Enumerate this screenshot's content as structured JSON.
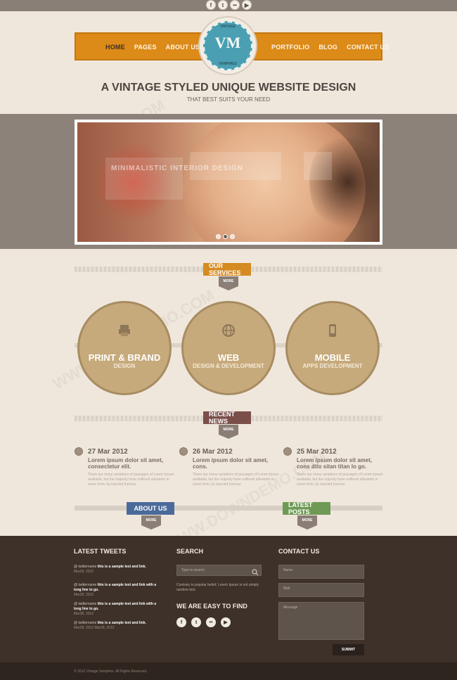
{
  "social_top": [
    "f",
    "t",
    "••",
    "▶"
  ],
  "nav": {
    "left": [
      "HOME",
      "PAGES",
      "ABOUT US"
    ],
    "right": [
      "PORTFOLIO",
      "BLOG",
      "CONTACT US"
    ]
  },
  "logo": {
    "top": "VINTAGE",
    "initials": "VM",
    "bottom": "VAMPIRES"
  },
  "hero": {
    "title": "A VINTAGE STYLED UNIQUE WEBSITE DESIGN",
    "subtitle": "THAT BEST SUITS YOUR NEED",
    "overlay_text": "MINIMALISTIC INTERIOR DESIGN"
  },
  "services": {
    "tag": "OUR SERVICES",
    "more": "MORE",
    "items": [
      {
        "title": "PRINT & BRAND",
        "sub": "DESIGN",
        "icon": "printer-icon"
      },
      {
        "title": "WEB",
        "sub": "DESIGN & DEVELOPMENT",
        "icon": "globe-icon"
      },
      {
        "title": "MOBILE",
        "sub": "APPS DEVELOPMENT",
        "icon": "mobile-icon"
      }
    ]
  },
  "news": {
    "tag": "RECENT NEWS",
    "more": "MORE",
    "items": [
      {
        "date": "27 Mar 2012",
        "headline": "Lorem ipsum dolor sit amet, consectetur elit.",
        "body": "There are many variations of passages of Lorem Ipsum available, but the majority have suffered alteration in some form, by injected humour."
      },
      {
        "date": "26 Mar 2012",
        "headline": "Lorem ipsum dolor sit amet, cons.",
        "body": "There are many variations of passages of Lorem Ipsum available, but the majority have suffered alteration in some form, by injected humour."
      },
      {
        "date": "25 Mar 2012",
        "headline": "Lorem ipsum dolor sit amet, cons dito sitan titan lo go.",
        "body": "There are many variations of passages of Lorem Ipsum available, but the majority have suffered alteration in some form, by injected humour."
      }
    ]
  },
  "about": {
    "tag": "ABOUT US",
    "more": "MORE"
  },
  "latest_posts": {
    "tag": "LATEST POSTS",
    "more": "MORE"
  },
  "footer": {
    "tweets_head": "LATEST TWEETS",
    "tweets": [
      {
        "user": "@ twittername",
        "text": "this is a sample text and link.",
        "date": "Mar28, 2012"
      },
      {
        "user": "@ twittername",
        "text": "this is a sample text and link with a long line to go.",
        "date": "Mar28, 2012"
      },
      {
        "user": "@ twittername",
        "text": "this is a sample text and link with a long line to go.",
        "date": "Mar28, 2012"
      },
      {
        "user": "@ twittername",
        "text": "this is a sample text and link.",
        "date": "Mar28, 2012 Mar28, 2012"
      }
    ],
    "search_head": "SEARCH",
    "search_placeholder": "Type to search",
    "search_note": "Contrary to popular belief, Lorem Ipsum is not simply random text.",
    "easy_head": "WE ARE EASY TO FIND",
    "easy_social": [
      "f",
      "t",
      "••",
      "▶"
    ],
    "contact_head": "CONTACT US",
    "name_placeholder": "Name",
    "mail_placeholder": "Mail",
    "message_placeholder": "Message",
    "submit": "SUBMIT",
    "copyright": "© 2012 Vintage Vampires. All Rights Reserved."
  },
  "watermark": "WWW.DOWNDEMO.COM",
  "colors": {
    "nav": "#dc8a18",
    "logo": "#4a9fb2",
    "services_tag": "#d68a22",
    "news_tag": "#7a4f4a",
    "about_tag": "#4b6a9a",
    "posts_tag": "#6e9a55",
    "circle": "#c7aa7c",
    "footer": "#3e3129"
  }
}
